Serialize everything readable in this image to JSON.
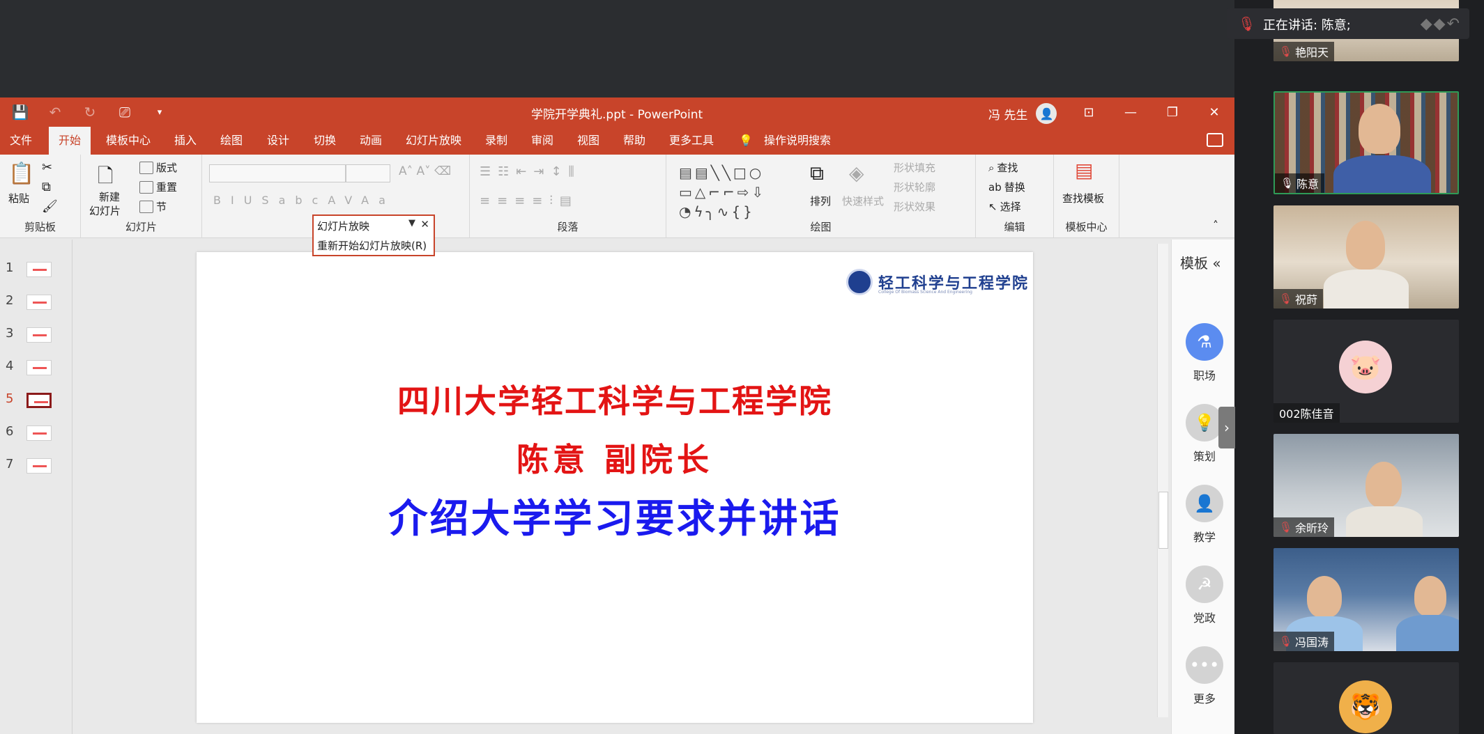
{
  "window": {
    "title": "学院开学典礼.ppt - PowerPoint",
    "user": "冯 先生"
  },
  "tabs": [
    "文件",
    "开始",
    "模板中心",
    "插入",
    "绘图",
    "设计",
    "切换",
    "动画",
    "幻灯片放映",
    "录制",
    "审阅",
    "视图",
    "帮助",
    "更多工具"
  ],
  "active_tab": "开始",
  "tell_me": "操作说明搜索",
  "ribbon": {
    "clipboard": {
      "paste": "粘贴",
      "label": "剪贴板"
    },
    "slides": {
      "new_line1": "新建",
      "new_line2": "幻灯片",
      "layout": "版式",
      "reset": "重置",
      "section": "节",
      "label": "幻灯片"
    },
    "paragraph": {
      "label": "段落"
    },
    "drawing": {
      "arrange": "排列",
      "quick_styles": "快速样式",
      "shape_fill": "形状填充",
      "shape_outline": "形状轮廓",
      "shape_effects": "形状效果",
      "label": "绘图"
    },
    "editing": {
      "find": "查找",
      "replace": "替换",
      "select": "选择",
      "label": "编辑"
    },
    "template": {
      "find_template": "查找模板",
      "label": "模板中心"
    }
  },
  "popup": {
    "title": "幻灯片放映",
    "item": "重新开始幻灯片放映(R)"
  },
  "thumbnails": {
    "numbers": [
      "1",
      "2",
      "3",
      "4",
      "5",
      "6",
      "7"
    ],
    "selected": "5"
  },
  "slide": {
    "logo_text": "轻工科学与工程学院",
    "logo_sub": "College Of Biomass Science And Engineering",
    "line1": "四川大学轻工科学与工程学院",
    "line2": "陈意 副院长",
    "line3": "介绍大学学习要求并讲话"
  },
  "template_panel": {
    "title": "模板",
    "items": [
      {
        "label": "职场",
        "icon": "flask-icon"
      },
      {
        "label": "策划",
        "icon": "bulb-icon"
      },
      {
        "label": "教学",
        "icon": "teacher-icon"
      },
      {
        "label": "党政",
        "icon": "party-icon"
      },
      {
        "label": "更多",
        "icon": "more-icon"
      }
    ]
  },
  "meeting": {
    "speaking": "正在讲话: 陈意;",
    "participants": [
      {
        "name": "艳阳天",
        "muted": true
      },
      {
        "name": "陈意",
        "muted": false
      },
      {
        "name": "祝莳",
        "muted": true
      },
      {
        "name": "002陈佳音",
        "muted": null
      },
      {
        "name": "余昕玲",
        "muted": true
      },
      {
        "name": "冯国涛",
        "muted": true
      }
    ]
  },
  "colors": {
    "ppt_accent": "#c8442a",
    "slide_red": "#e31414",
    "slide_blue": "#1a1aee",
    "active_speaker": "#2e9b57"
  }
}
